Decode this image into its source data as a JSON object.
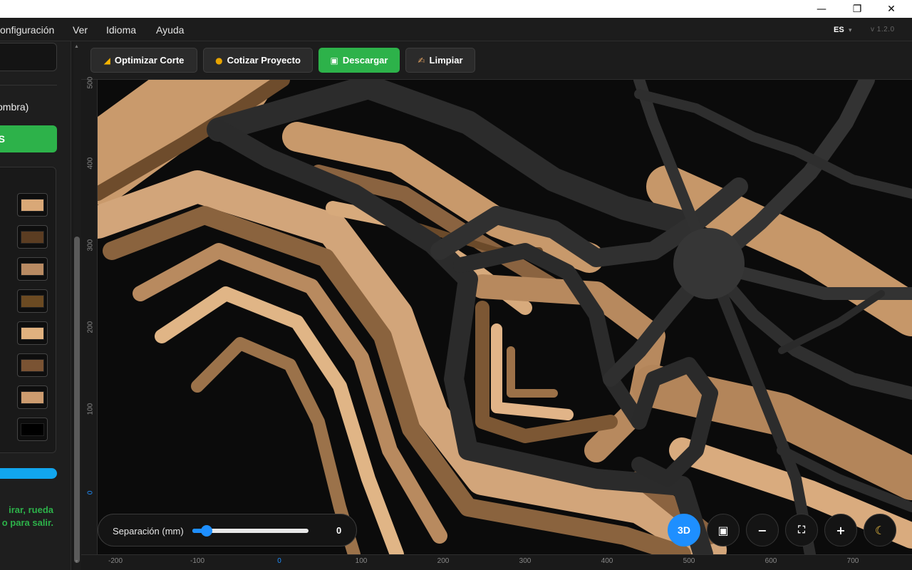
{
  "window": {
    "minimize_icon": "minimize-icon",
    "restore_icon": "restore-icon",
    "close_icon": "close-icon"
  },
  "menu": {
    "items": [
      "onfiguración",
      "Ver",
      "Idioma",
      "Ayuda"
    ],
    "language": "ES",
    "version": "v 1.2.0"
  },
  "toolbar": {
    "buttons": [
      {
        "label": "Optimizar Corte",
        "icon": "ruler-icon"
      },
      {
        "label": "Cotizar Proyecto",
        "icon": "money-bag-icon"
      },
      {
        "label": "Descargar",
        "icon": "floppy-disk-icon"
      },
      {
        "label": "Limpiar",
        "icon": "broom-icon"
      }
    ]
  },
  "sidebar": {
    "shadow_label": "ombra)",
    "green_button_label": "S",
    "swatches": [
      "#d9a877",
      "#5b3d22",
      "#b88a62",
      "#6b4a22",
      "#e0b17f",
      "#7a5333",
      "#cc9b6f",
      "#000000"
    ],
    "help_text": [
      "irar, rueda",
      "o para salir."
    ]
  },
  "rulers": {
    "vertical": [
      "500",
      "400",
      "300",
      "200",
      "100",
      "0"
    ],
    "horizontal": [
      "-200",
      "-100",
      "0",
      "100",
      "200",
      "300",
      "400",
      "500",
      "600",
      "700"
    ]
  },
  "separation": {
    "label": "Separación (mm)",
    "value": "0",
    "level": 0.12
  },
  "view_controls": [
    {
      "name": "view-3d-button",
      "label": "3D"
    },
    {
      "name": "view-2d-button",
      "icon": "square-view-icon"
    },
    {
      "name": "zoom-out-button",
      "icon": "minus-icon"
    },
    {
      "name": "fit-view-button",
      "icon": "fit-screen-icon"
    },
    {
      "name": "zoom-in-button",
      "icon": "plus-icon"
    },
    {
      "name": "dark-mode-button",
      "icon": "moon-icon"
    }
  ],
  "colors": {
    "accent": "#1e8fff",
    "green": "#2db24a",
    "progress": "#12a6ee"
  }
}
